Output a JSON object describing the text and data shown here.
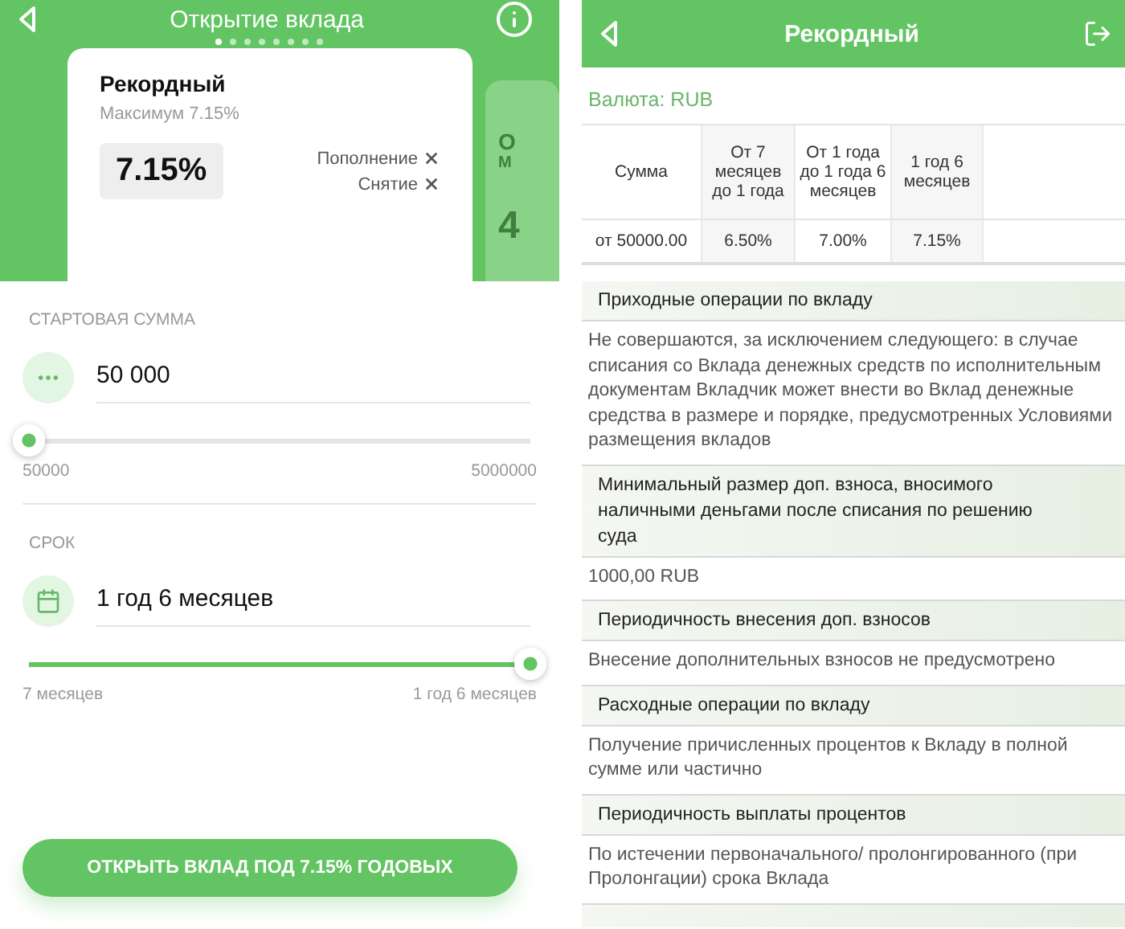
{
  "deposit_form": {
    "title": "Открытие вклада",
    "carousel_dots": [
      {
        "selected": true
      },
      {
        "selected": false
      },
      {
        "selected": false
      },
      {
        "selected": false
      },
      {
        "selected": false
      },
      {
        "selected": false
      },
      {
        "selected": false
      },
      {
        "selected": false
      }
    ],
    "card": {
      "name": "Рекордный",
      "subtitle": "Максимум 7.15%",
      "rate": "7.15%",
      "options": [
        {
          "label": "Пополнение",
          "available": false
        },
        {
          "label": "Снятие",
          "available": false
        }
      ]
    },
    "next_card": {
      "name": "О",
      "subtitle": "М",
      "rate": "4"
    },
    "parameters": [
      {
        "kind": "amount",
        "label": "СТАРТОВАЯ СУММА",
        "value": "50 000",
        "level": 0,
        "min_label": "50000",
        "max_label": "5000000"
      },
      {
        "kind": "term",
        "label": "СРОК",
        "value": "1 год 6 месяцев",
        "level": 1,
        "min_label": "7 месяцев",
        "max_label": "1 год 6 месяцев"
      }
    ],
    "button": "ОТКРЫТЬ ВКЛАД ПОД 7.15% ГОДОВЫХ"
  },
  "deposit_details": {
    "title": "Рекордный",
    "currency": "Валюта: RUB",
    "table": {
      "columns": [
        "Сумма",
        "От 7 месяцев до 1 года",
        "От 1 года до 1 года 6 месяцев",
        "1 год 6 месяцев"
      ],
      "rows": [
        [
          "от 50000.00",
          "6.50%",
          "7.00%",
          "7.15%"
        ]
      ]
    },
    "sections": [
      {
        "heading": "Приходные операции по вкладу",
        "text": "Не совершаются, за исключением следующего: в случае списания со Вклада денежных средств по исполнительным документам Вкладчик может внести во Вклад денежные средства в размере и порядке, предусмотренных Условиями размещения вкладов"
      },
      {
        "heading": "Минимальный размер доп. взноса, вносимого наличными деньгами после списания по решению суда",
        "text": "1000,00 RUB"
      },
      {
        "heading": "Периодичность внесения доп. взносов",
        "text": "Внесение дополнительных взносов не предусмотрено"
      },
      {
        "heading": "Расходные операции по вкладу",
        "text": "Получение причисленных процентов к Вкладу в полной сумме или частично"
      },
      {
        "heading": "Периодичность выплаты процентов",
        "text": "По истечении первоначального/ пролонгированного (при Пролонгации) срока Вклада"
      }
    ]
  }
}
